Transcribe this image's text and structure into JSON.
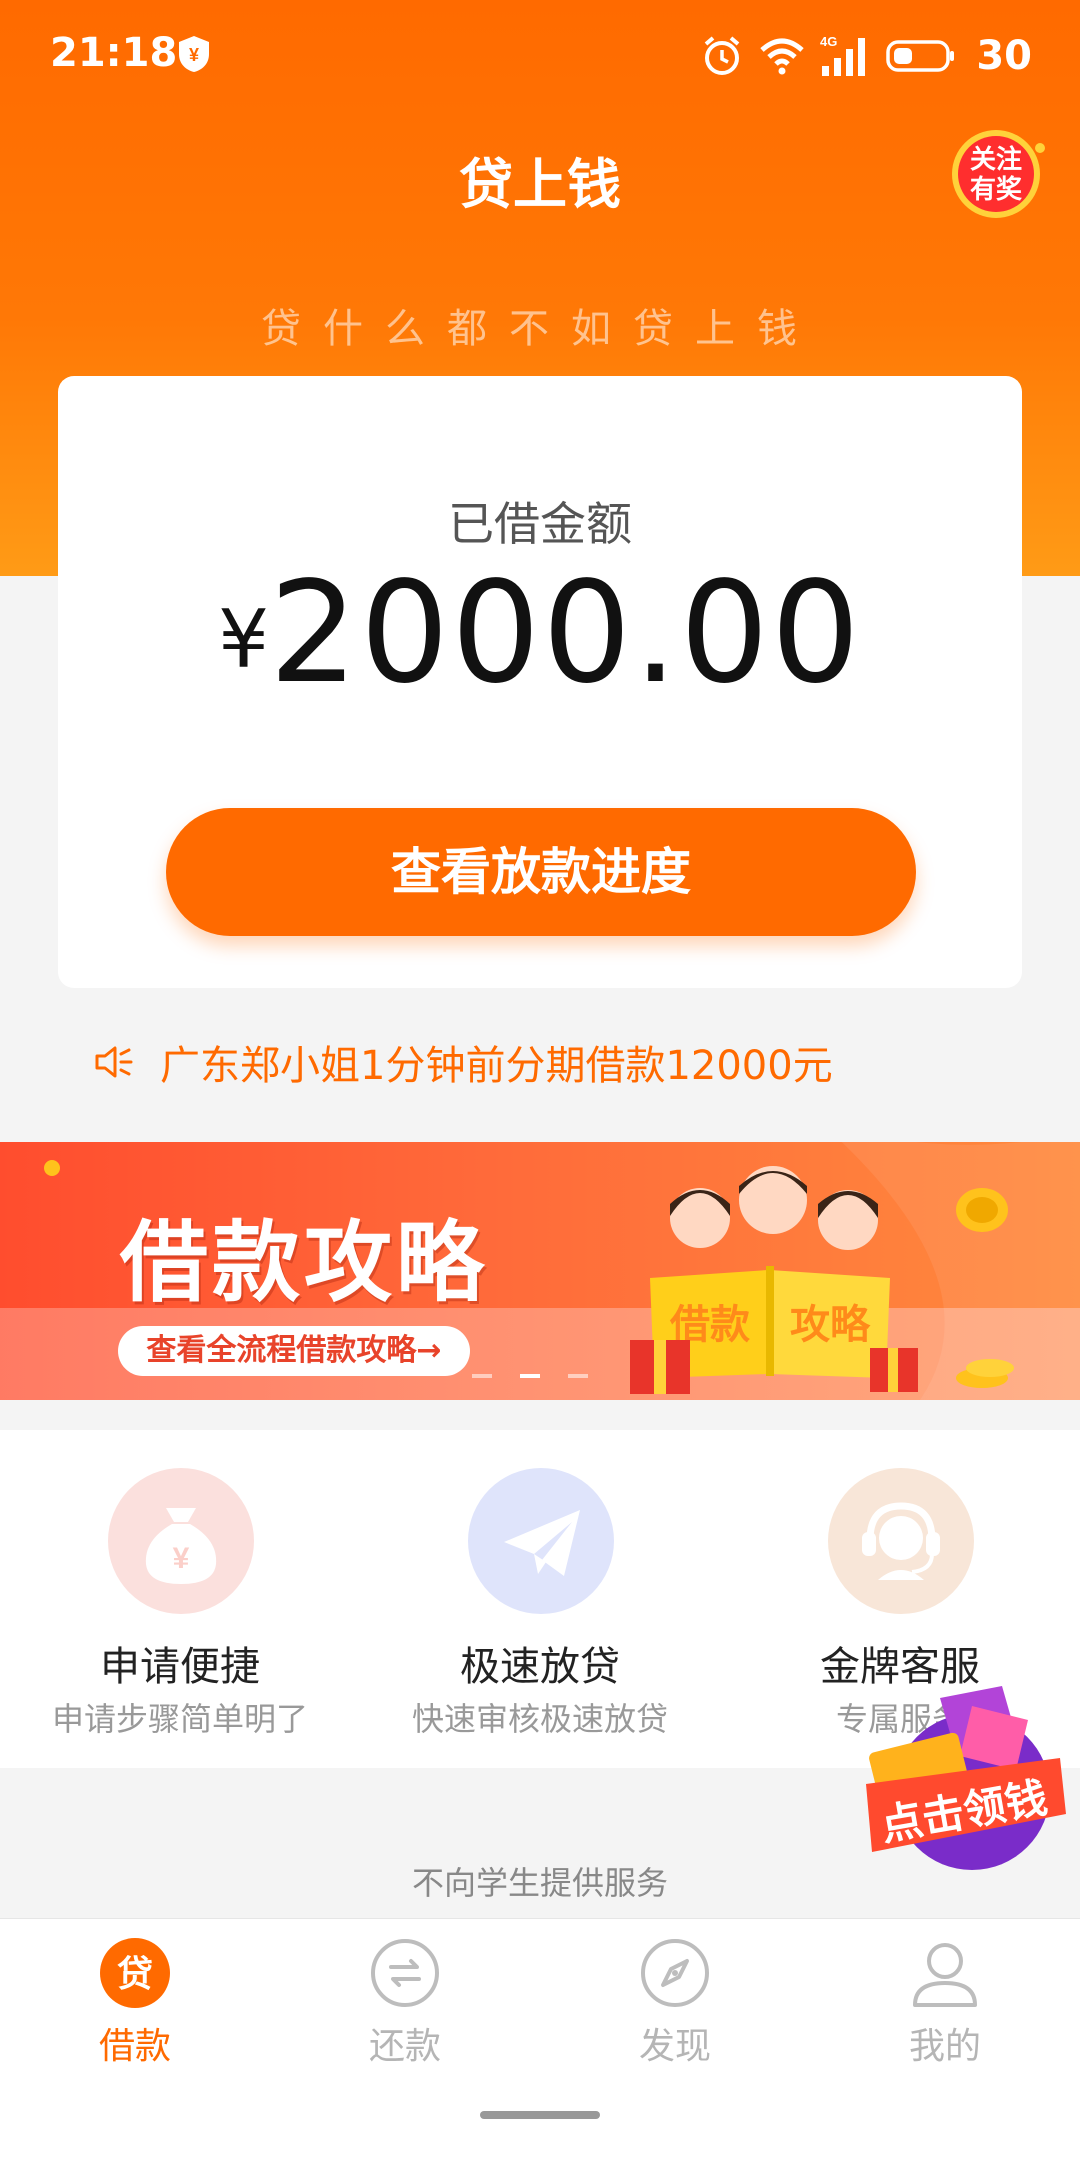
{
  "status_bar": {
    "time": "21:18",
    "battery": "30",
    "network": "4G"
  },
  "header": {
    "title": "贷上钱",
    "badge_text": "关注有奖",
    "slogan": "贷什么都不如贷上钱"
  },
  "loan_card": {
    "label": "已借金额",
    "currency": "¥",
    "amount": "2000.00",
    "button_label": "查看放款进度"
  },
  "notice": {
    "text": "广东郑小姐1分钟前分期借款12000元"
  },
  "banner": {
    "title": "借款攻略",
    "link_text": "查看全流程借款攻略→",
    "book_left": "借款",
    "book_right": "攻略",
    "active_slide": 2,
    "slide_count": 3
  },
  "features": [
    {
      "title": "申请便捷",
      "subtitle": "申请步骤简单明了",
      "icon": "money-bag-icon",
      "color": "#fbe0dd"
    },
    {
      "title": "极速放贷",
      "subtitle": "快速审核极速放贷",
      "icon": "paper-plane-icon",
      "color": "#dfe4fb"
    },
    {
      "title": "金牌客服",
      "subtitle": "专属服务",
      "icon": "headset-icon",
      "color": "#f8e6d8"
    }
  ],
  "float_badge": {
    "text": "点击领钱"
  },
  "footer_note": "不向学生提供服务",
  "tabs": [
    {
      "label": "借款",
      "icon": "loan-icon",
      "active": true
    },
    {
      "label": "还款",
      "icon": "repay-icon",
      "active": false
    },
    {
      "label": "发现",
      "icon": "compass-icon",
      "active": false
    },
    {
      "label": "我的",
      "icon": "user-icon",
      "active": false
    }
  ],
  "colors": {
    "accent": "#ff6a00",
    "text_muted": "#999999"
  }
}
